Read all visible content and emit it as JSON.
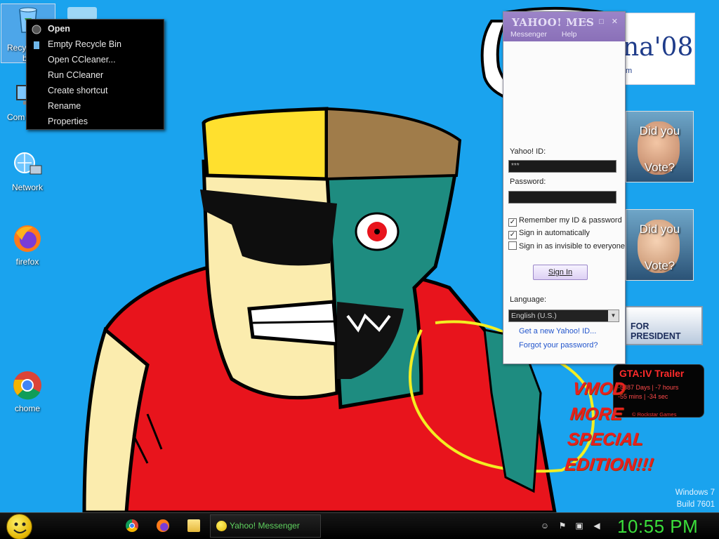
{
  "desktop": {
    "icons": [
      {
        "label": "Recycle Bin",
        "visible_label_part1": "Recy",
        "visible_label_part2": "b"
      },
      {
        "label": "Computer",
        "visible_label_part": "Com"
      },
      {
        "label": "Network"
      },
      {
        "label": "firefox"
      },
      {
        "label": "chome"
      }
    ]
  },
  "context_menu": {
    "items": [
      "Open",
      "Empty Recycle Bin",
      "Open CCleaner...",
      "Run CCleaner",
      "Create shortcut",
      "Rename",
      "Properties"
    ]
  },
  "yahoo_window": {
    "brand": "YAHOO! MES",
    "window_buttons": "— □ ✕",
    "menu": [
      "Messenger",
      "Help"
    ],
    "id_label": "Yahoo! ID:",
    "id_value": "***",
    "password_label": "Password:",
    "options": [
      {
        "label": "Remember my ID & password",
        "checked": true
      },
      {
        "label": "Sign in automatically",
        "checked": true
      },
      {
        "label": "Sign in as invisible to everyone",
        "checked": false
      }
    ],
    "signin_label": "Sign In",
    "language_label": "Language:",
    "language_value": "English (U.S.)",
    "links": [
      "Get a new Yahoo! ID...",
      "Forgot your password?"
    ]
  },
  "widgets": {
    "obama_text": "na'08",
    "obama_sub": "m",
    "vote_a": {
      "line1": "Did you",
      "line2": "Vote?"
    },
    "vote_b": {
      "line1": "Did you",
      "line2": "Vote?"
    },
    "for_president": "FOR PRESIDENT",
    "gta": {
      "title": "GTA:IV  Trailer",
      "line1": "-5887 Days  |  -7 hours",
      "line2": "-55 mins  |  -34 sec",
      "footer": "©  Rockstar Games"
    },
    "vmod_lines": [
      "VMOD",
      "MORE",
      "SPECIAL",
      "EDITION!!!"
    ]
  },
  "os_version": {
    "line1": "Windows 7",
    "line2": "Build 7601"
  },
  "taskbar": {
    "active_task": "Yahoo! Messenger",
    "clock": "10:55 PM",
    "tray_icons": [
      "messenger-tray-icon",
      "action-center-icon",
      "network-icon",
      "volume-icon"
    ]
  },
  "colors": {
    "desktop_bg": "#1aa3ee",
    "clock": "#3bde3b",
    "yahoo_purple": "#8a70b8"
  }
}
